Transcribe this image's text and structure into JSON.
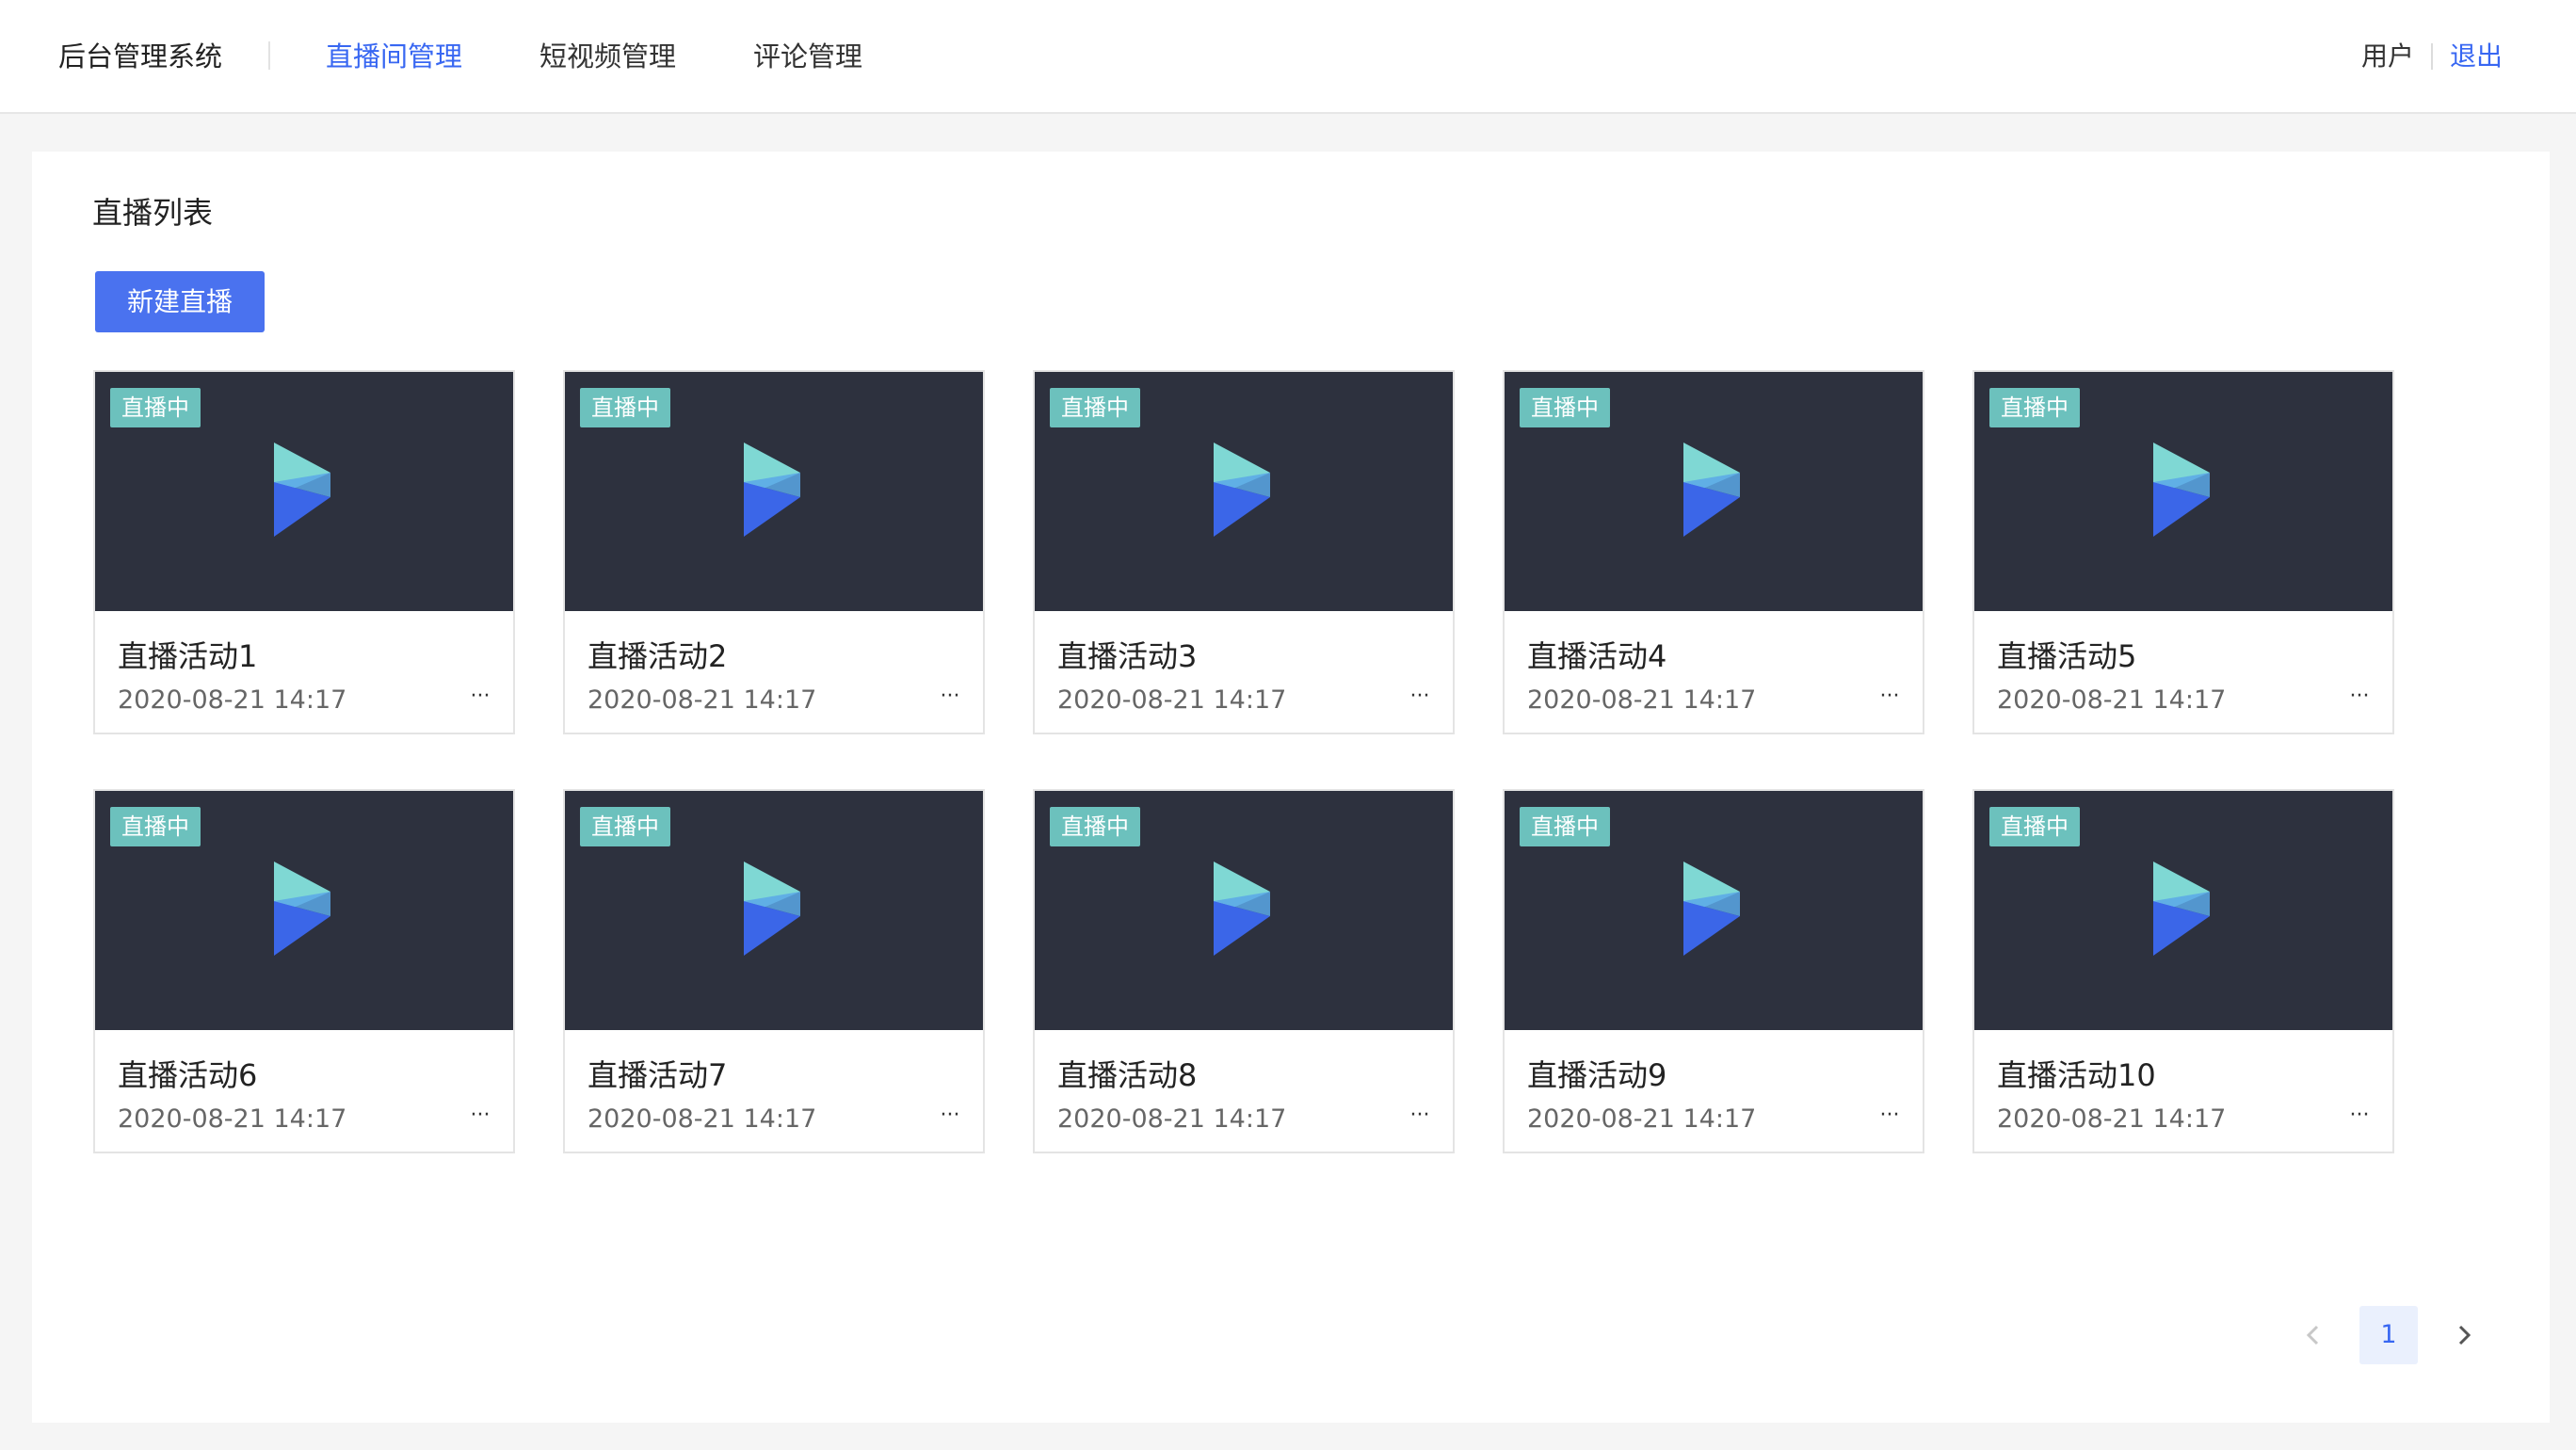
{
  "header": {
    "brand": "后台管理系统",
    "nav": [
      {
        "label": "直播间管理",
        "active": true
      },
      {
        "label": "短视频管理",
        "active": false
      },
      {
        "label": "评论管理",
        "active": false
      }
    ],
    "user_label": "用户",
    "logout_label": "退出"
  },
  "main": {
    "title": "直播列表",
    "create_button": "新建直播",
    "cards": [
      {
        "badge": "直播中",
        "title": "直播活动1",
        "date": "2020-08-21 14:17",
        "more": "···"
      },
      {
        "badge": "直播中",
        "title": "直播活动2",
        "date": "2020-08-21 14:17",
        "more": "···"
      },
      {
        "badge": "直播中",
        "title": "直播活动3",
        "date": "2020-08-21 14:17",
        "more": "···"
      },
      {
        "badge": "直播中",
        "title": "直播活动4",
        "date": "2020-08-21 14:17",
        "more": "···"
      },
      {
        "badge": "直播中",
        "title": "直播活动5",
        "date": "2020-08-21 14:17",
        "more": "···"
      },
      {
        "badge": "直播中",
        "title": "直播活动6",
        "date": "2020-08-21 14:17",
        "more": "···"
      },
      {
        "badge": "直播中",
        "title": "直播活动7",
        "date": "2020-08-21 14:17",
        "more": "···"
      },
      {
        "badge": "直播中",
        "title": "直播活动8",
        "date": "2020-08-21 14:17",
        "more": "···"
      },
      {
        "badge": "直播中",
        "title": "直播活动9",
        "date": "2020-08-21 14:17",
        "more": "···"
      },
      {
        "badge": "直播中",
        "title": "直播活动10",
        "date": "2020-08-21 14:17",
        "more": "···"
      }
    ],
    "pagination": {
      "current_page": "1",
      "prev_icon": "chevron-left-icon",
      "next_icon": "chevron-right-icon"
    }
  },
  "colors": {
    "accent": "#3867f2",
    "button": "#4a72ef",
    "badge": "#6cc1bd",
    "thumb_bg": "#2d313e"
  }
}
